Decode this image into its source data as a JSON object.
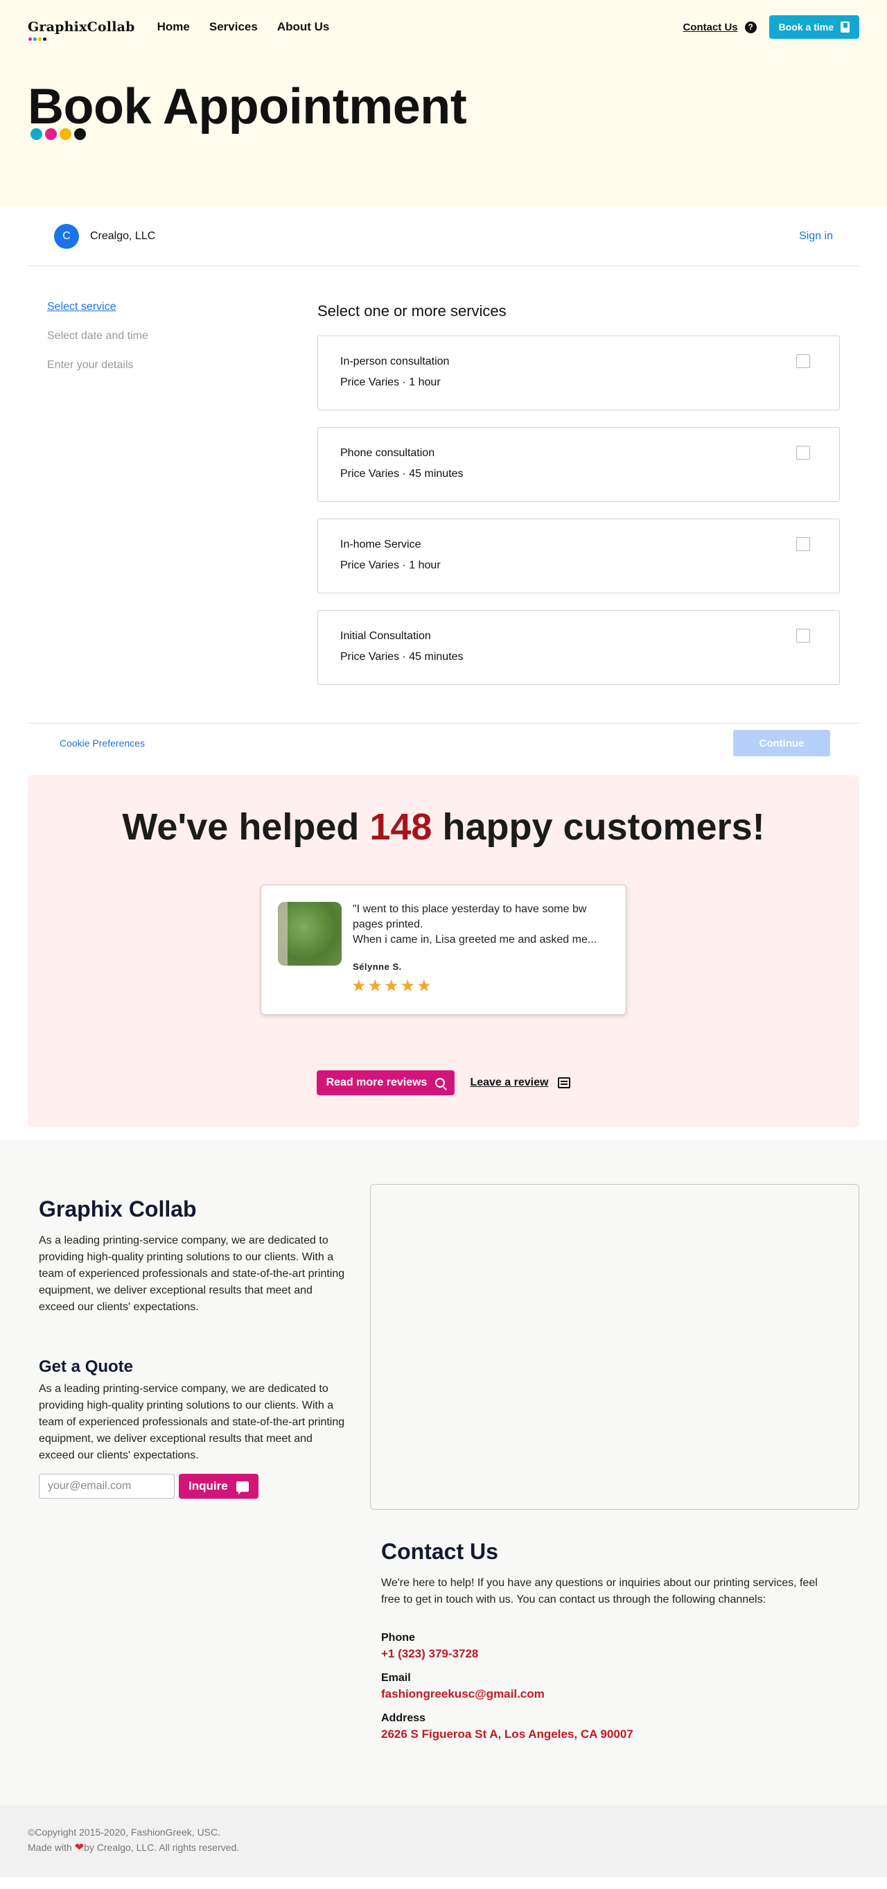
{
  "nav": {
    "logo": "GraphixCollab",
    "logo_dot_colors": [
      "#e61d8c",
      "#13a8d0",
      "#f5b800",
      "#111111"
    ],
    "links": [
      "Home",
      "Services",
      "About Us"
    ],
    "contact": "Contact Us",
    "help_icon": "?",
    "book_button": "Book a time"
  },
  "hero": {
    "title": "Book Appointment",
    "dot_colors": [
      "#13a8d0",
      "#e61d8c",
      "#f5b800",
      "#111111"
    ]
  },
  "booking": {
    "avatar_initial": "C",
    "business_name": "Crealgo, LLC",
    "sign_in": "Sign in",
    "steps": [
      "Select service",
      "Select date and time",
      "Enter your details"
    ],
    "services_heading": "Select one or more services",
    "services": [
      {
        "name": "In-person consultation",
        "meta": "Price Varies · 1 hour",
        "checked": false
      },
      {
        "name": "Phone consultation",
        "meta": "Price Varies · 45 minutes",
        "checked": false
      },
      {
        "name": "In-home Service",
        "meta": "Price Varies · 1 hour",
        "checked": false
      },
      {
        "name": "Initial Consultation",
        "meta": "Price Varies · 45 minutes",
        "checked": false
      }
    ],
    "cookie_link": "Cookie Preferences",
    "continue_label": "Continue"
  },
  "reviews": {
    "title_prefix": "We've helped ",
    "count": "148",
    "title_suffix": " happy customers!",
    "card": {
      "text": "\"I went to this place yesterday to have some bw pages printed.\nWhen i came in, Lisa greeted me and asked me...",
      "author": "Sélynne S.",
      "stars": 5
    },
    "read_more": "Read more reviews",
    "leave": "Leave a review"
  },
  "about": {
    "title": "Graphix Collab",
    "text": "As a leading printing-service company, we are dedicated to providing high-quality printing solutions to our clients. With a team of experienced professionals and state-of-the-art printing equipment, we deliver exceptional results that meet and exceed our clients' expectations."
  },
  "quote": {
    "title": "Get a Quote",
    "text": "As a leading printing-service company, we are dedicated to providing high-quality printing solutions to our clients. With a team of experienced professionals and state-of-the-art printing equipment, we deliver exceptional results that meet and exceed our clients' expectations.",
    "email_placeholder": "your@email.com",
    "button": "Inquire"
  },
  "contact": {
    "title": "Contact Us",
    "text": "We're here to help! If you have any questions or inquiries about our printing services, feel free to get in touch with us. You can contact us through the following channels:",
    "phone_label": "Phone",
    "phone": "+1 (323) 379-3728",
    "email_label": "Email",
    "email": "fashiongreekusc@gmail.com",
    "address_label": "Address",
    "address": "2626 S Figueroa St A, Los Angeles, CA 90007"
  },
  "footer": {
    "copyright": "©Copyright 2015-2020, FashionGreek, USC.",
    "made_prefix": "Made with ",
    "heart": "❤",
    "made_suffix": "by Crealgo, LLC. All rights reserved."
  }
}
